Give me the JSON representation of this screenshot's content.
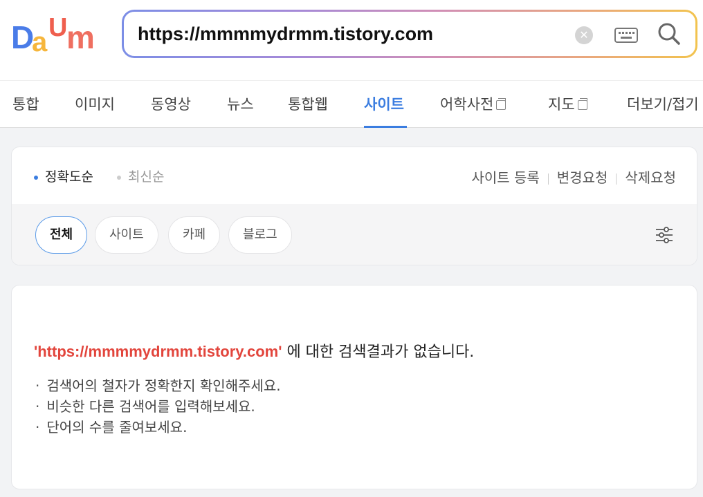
{
  "header": {
    "logo_text": "DAUM",
    "search": {
      "value": "https://mmmmydrmm.tistory.com",
      "clear_icon": "close-circle-icon",
      "keyboard_icon": "keyboard-icon",
      "search_icon": "magnifier-icon"
    }
  },
  "tabs": [
    {
      "label": "통합"
    },
    {
      "label": "이미지"
    },
    {
      "label": "동영상"
    },
    {
      "label": "뉴스"
    },
    {
      "label": "통합웹"
    },
    {
      "label": "사이트",
      "active": true
    },
    {
      "label": "어학사전",
      "external": true
    },
    {
      "label": "지도",
      "external": true
    },
    {
      "label": "더보기/접기"
    }
  ],
  "sort": {
    "options": [
      {
        "label": "정확도순",
        "selected": true
      },
      {
        "label": "최신순",
        "selected": false
      }
    ],
    "links": [
      "사이트 등록",
      "변경요청",
      "삭제요청"
    ]
  },
  "filters": {
    "chips": [
      {
        "label": "전체",
        "active": true
      },
      {
        "label": "사이트"
      },
      {
        "label": "카페"
      },
      {
        "label": "블로그"
      }
    ],
    "settings_icon": "filter-sliders-icon"
  },
  "result": {
    "query_display": "'https://mmmmydrmm.tistory.com'",
    "message": " 에 대한 검색결과가 없습니다.",
    "tips": [
      "검색어의 철자가 정확한지 확인해주세요.",
      "비슷한 다른 검색어를 입력해보세요.",
      "단어의 수를 줄여보세요."
    ]
  },
  "colors": {
    "accent": "#3b7de0",
    "query_red": "#e2453c"
  }
}
